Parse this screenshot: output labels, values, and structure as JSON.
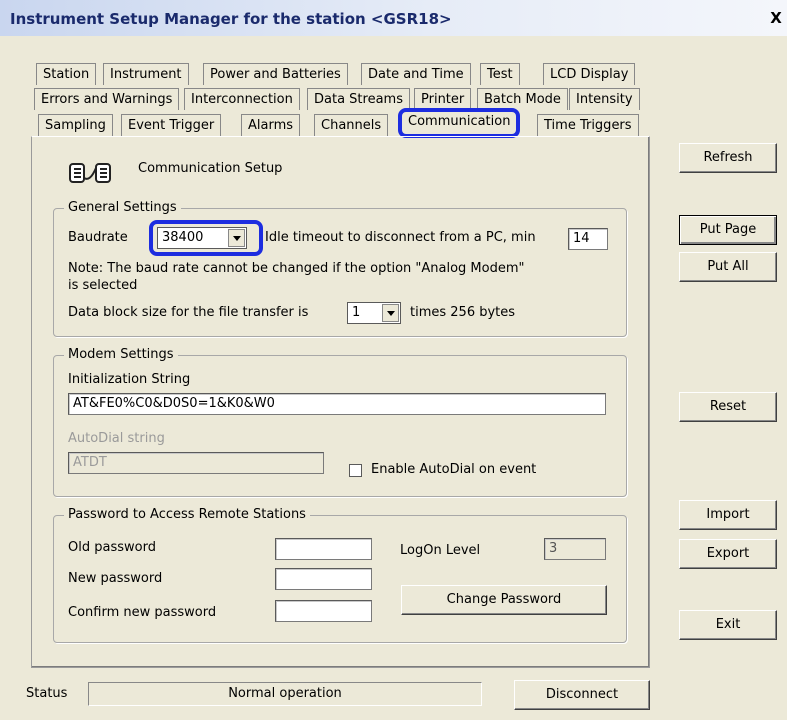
{
  "window": {
    "title": "Instrument Setup Manager for the station <GSR18>",
    "close": "X"
  },
  "tabs": {
    "row1": [
      "Station",
      "Instrument",
      "Power and Batteries",
      "Date and Time",
      "Test",
      "LCD Display"
    ],
    "row2": [
      "Errors and Warnings",
      "Interconnection",
      "Data Streams",
      "Printer",
      "Batch Mode",
      "Intensity"
    ],
    "row3": [
      "Sampling",
      "Event Trigger",
      "Alarms",
      "Channels",
      "Communication",
      "Time Triggers"
    ],
    "selected": "Communication"
  },
  "page": {
    "heading": "Communication Setup",
    "icon": "communication-icon"
  },
  "general": {
    "legend": "General Settings",
    "baudrate_label": "Baudrate",
    "baudrate_value": "38400",
    "idle_label": "Idle timeout to disconnect from a PC, min",
    "idle_value": "14",
    "note_line1": "Note: The baud rate cannot be changed if the option \"Analog Modem\"",
    "note_line2": "is selected",
    "block_label": "Data block size for the file transfer is",
    "block_value": "1",
    "block_suffix": "times 256 bytes"
  },
  "modem": {
    "legend": "Modem Settings",
    "init_label": "Initialization String",
    "init_value": "AT&FE0%C0&D0S0=1&K0&W0",
    "autodial_label": "AutoDial string",
    "autodial_value": "ATDT",
    "enable_label": "Enable AutoDial on event"
  },
  "password": {
    "legend": "Password to Access Remote Stations",
    "old_label": "Old password",
    "new_label": "New password",
    "confirm_label": "Confirm new password",
    "logon_label": "LogOn Level",
    "logon_value": "3",
    "change_button": "Change Password"
  },
  "buttons": {
    "refresh": "Refresh",
    "put_page": "Put Page",
    "put_all": "Put All",
    "reset": "Reset",
    "import": "Import",
    "export": "Export",
    "exit": "Exit"
  },
  "status": {
    "label": "Status",
    "value": "Normal operation",
    "disconnect": "Disconnect"
  },
  "colors": {
    "highlight": "#1d2de0",
    "face": "#ece9d8"
  }
}
